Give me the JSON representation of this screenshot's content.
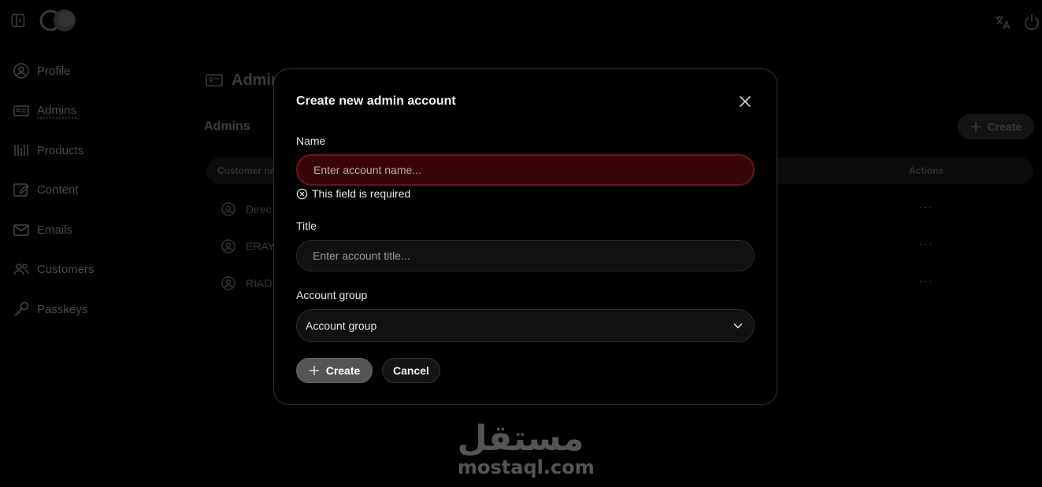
{
  "topbar": {
    "sidebar_toggle_icon": "sidebar-toggle-icon",
    "logo_icon": "app-logo",
    "language_icon": "translate-icon",
    "power_icon": "power-icon"
  },
  "sidebar": {
    "items": [
      {
        "label": "Profile",
        "icon": "user-circle-icon"
      },
      {
        "label": "Admins",
        "icon": "id-card-icon",
        "active": true
      },
      {
        "label": "Products",
        "icon": "products-icon"
      },
      {
        "label": "Content",
        "icon": "content-icon"
      },
      {
        "label": "Emails",
        "icon": "mail-icon"
      },
      {
        "label": "Customers",
        "icon": "users-icon"
      },
      {
        "label": "Passkeys",
        "icon": "key-icon"
      }
    ]
  },
  "main": {
    "page_title": "Admins",
    "section_title": "Admins",
    "create_label": "Create",
    "table": {
      "headers": {
        "customer": "Customer na",
        "actions": "Actions"
      },
      "rows": [
        {
          "name": "Direc",
          "actions": "···"
        },
        {
          "name": "ERAY",
          "actions": "···"
        },
        {
          "name": "RIAD",
          "actions": "···"
        }
      ]
    }
  },
  "modal": {
    "title": "Create new admin account",
    "name_label": "Name",
    "name_placeholder": "Enter account name...",
    "name_value": "",
    "name_error": "This field is required",
    "title_label": "Title",
    "title_placeholder": "Enter account title...",
    "title_value": "",
    "group_label": "Account group",
    "group_value": "Account group",
    "create_label": "Create",
    "cancel_label": "Cancel"
  },
  "watermark": {
    "arabic": "مستقل",
    "latin": "mostaql.com"
  },
  "colors": {
    "background": "#000000",
    "error_field": "#3a0508",
    "primary_button": "#555555"
  }
}
